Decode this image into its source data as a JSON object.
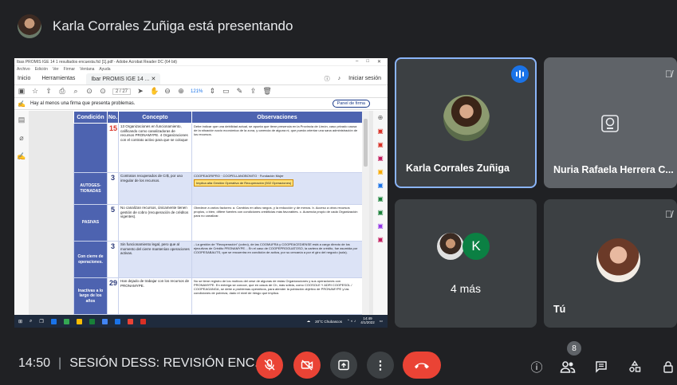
{
  "presenter": {
    "text": "Karla Corrales Zuñiga está presentando"
  },
  "shared_screen": {
    "window_title": "Ibas PROMIS IGE 14 1 resultados encuesta.ficl [1].pdf - Adobe Acrobat Reader DC (64 bit)",
    "menu": [
      "Archivo",
      "Edición",
      "Ver",
      "Firmar",
      "Ventana",
      "Ayuda"
    ],
    "tabs": [
      "Inicio",
      "Herramientas",
      "Ibar PROMIS IGE 14 ..."
    ],
    "signin_label": "Iniciar sesión",
    "page_indicator": "2 / 27",
    "zoom": "121%",
    "notice": "Hay al menos una firma que presenta problemas.",
    "sign_panel_label": "Panel de firma",
    "table": {
      "headers": [
        "Condición",
        "No.",
        "Concepto",
        "Observaciones"
      ],
      "rows": [
        {
          "condition": "",
          "number": "15",
          "concept": "13 Organizaciones en funcionamiento, calificando como canalizadoras de recursos PRONAMYPE. 4 Organizaciones con el contrato activo para que se coloque",
          "observation": "Debe indicar que una debilidad actual, se apunta que tiene presencia en la Provincia de Limón, caso privado causa de la situación socio económica de la zona, y carencia de alguna ni, que pueda orientar una sana administración de los recursos.",
          "highlight": ""
        },
        {
          "condition": "AUTOGES-TIONADAS",
          "number": "3",
          "concept": "Contratos recuperados de Cr$, por uso irregular de los recursos.",
          "observation": "COOPEAGRIPRO · COOPELLANOBONITO · Fundación Mujer",
          "highlight": "Implica alta Gestión Operativa de Recuperación (502 Operaciones)"
        },
        {
          "condition": "PASIVAS",
          "number": "5",
          "concept": "No canalizan recursos, únicamente tienen gestión de cobro (recuperación de créditos vigentes).",
          "observation": "Obedece a varios factores: a. Cambios en altos rangos, y la reducción y de menos. b. Acceso a otros recursos propios, o bien, difiere fuentes con condiciones crediticias más favorables. c. Ausencia propio de cada Organización para no canalizar.",
          "highlight": ""
        },
        {
          "condition": "Con cierre de operaciones.",
          "number": "3",
          "concept": "Sin funcionamiento legal, pero que al momento del cierre mantenían operaciones activas.",
          "observation": "- La gestión de \"Recuperación\" (cobro), de las COOMUFRA y COOPEACEDIENSE está a cargo directo de los ejecutivos de Crédito PRONAMYPE. - En el caso de COOPEPROGUATOSO, la cartera de crédito, fue asumida por COOPESABAUTS, que se encuentra en condición de activa, por su cercanía a por el giro del negocio (sola).",
          "highlight": ""
        },
        {
          "condition": "Inactivas a lo largo de los años",
          "number": "29",
          "concept": "Han dejado de trabajar con los recursos de PRONAMYPE.",
          "observation": "No se tiene registro de los motivos del cese de algunas de estas Organizaciones y sus operaciones con PRONAMYPE. En entrega se conoce, que en casos de Ch, más sólida, como COOSOLE Y ADRI COOPESOL / COOPEAGANGA, se debe a problemas operativos, para atender la población objetivo de PRONAMYPE y las condiciones de pobreza, dado el nivel de riesgo que implica.",
          "highlight": ""
        }
      ]
    },
    "taskbar": {
      "weather": "20°C Chubascos",
      "time": "14:49",
      "date": "4/1/2022"
    }
  },
  "participants": {
    "karla_name": "Karla Corrales Zuñiga",
    "nuria_name": "Nuria Rafaela Herrera C...",
    "more_avatar_letter": "K",
    "more_label": "4 más",
    "you_label": "Tú"
  },
  "controls": {
    "time": "14:50",
    "meeting_name": "SESIÓN DESS: REVISIÓN ENC...",
    "people_count": "8"
  },
  "colors": {
    "background": "#202124",
    "danger": "#ea4335",
    "active_speaker": "#1a73e8",
    "table_header": "#4d63b0"
  }
}
